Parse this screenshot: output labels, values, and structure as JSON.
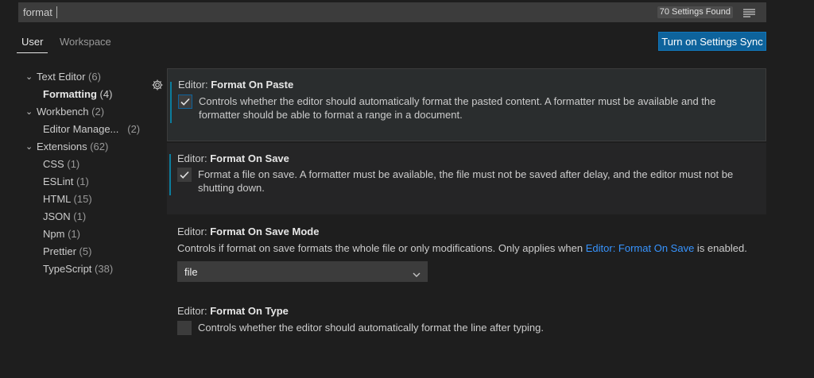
{
  "search": {
    "value": "format",
    "results_count": "70 Settings Found"
  },
  "tabs": [
    {
      "label": "User",
      "active": true
    },
    {
      "label": "Workspace",
      "active": false
    }
  ],
  "sync_button": {
    "label": "Turn on Settings Sync"
  },
  "toc": [
    {
      "label": "Text Editor",
      "count": "(6)",
      "expanded": true
    },
    {
      "label": "Formatting",
      "count": "(4)",
      "selected": true
    },
    {
      "label": "Workbench",
      "count": "(2)",
      "expanded": true
    },
    {
      "label": "Editor Manage...",
      "count": "(2)"
    },
    {
      "label": "Extensions",
      "count": "(62)",
      "expanded": true
    },
    {
      "label": "CSS",
      "count": "(1)"
    },
    {
      "label": "ESLint",
      "count": "(1)"
    },
    {
      "label": "HTML",
      "count": "(15)"
    },
    {
      "label": "JSON",
      "count": "(1)"
    },
    {
      "label": "Npm",
      "count": "(1)"
    },
    {
      "label": "Prettier",
      "count": "(5)"
    },
    {
      "label": "TypeScript",
      "count": "(38)"
    }
  ],
  "settings": {
    "format_on_paste": {
      "category": "Editor: ",
      "key": "Format On Paste",
      "checked": true,
      "desc_line1": "Controls whether the editor should automatically format the pasted content. A formatter must be available and the",
      "desc_line2": "formatter should be able to format a range in a document."
    },
    "format_on_save": {
      "category": "Editor: ",
      "key": "Format On Save",
      "checked": true,
      "desc_line1": "Format a file on save. A formatter must be available, the file must not be saved after delay, and the editor must not be",
      "desc_line2": "shutting down."
    },
    "format_on_save_mode": {
      "category": "Editor: ",
      "key": "Format On Save Mode",
      "desc_before": "Controls if format on save formats the whole file or only modifications. Only applies when ",
      "desc_link": "Editor: Format On Save",
      "desc_after": " is enabled.",
      "value": "file"
    },
    "format_on_type": {
      "category": "Editor: ",
      "key": "Format On Type",
      "checked": false,
      "desc_line1": "Controls whether the editor should automatically format the line after typing."
    }
  },
  "colors": {
    "background": "#1e1e1e",
    "input": "#3c3c3c",
    "accent_button": "#0e639c",
    "link": "#3794ff",
    "modified_indicator": "#0c7d9d"
  }
}
